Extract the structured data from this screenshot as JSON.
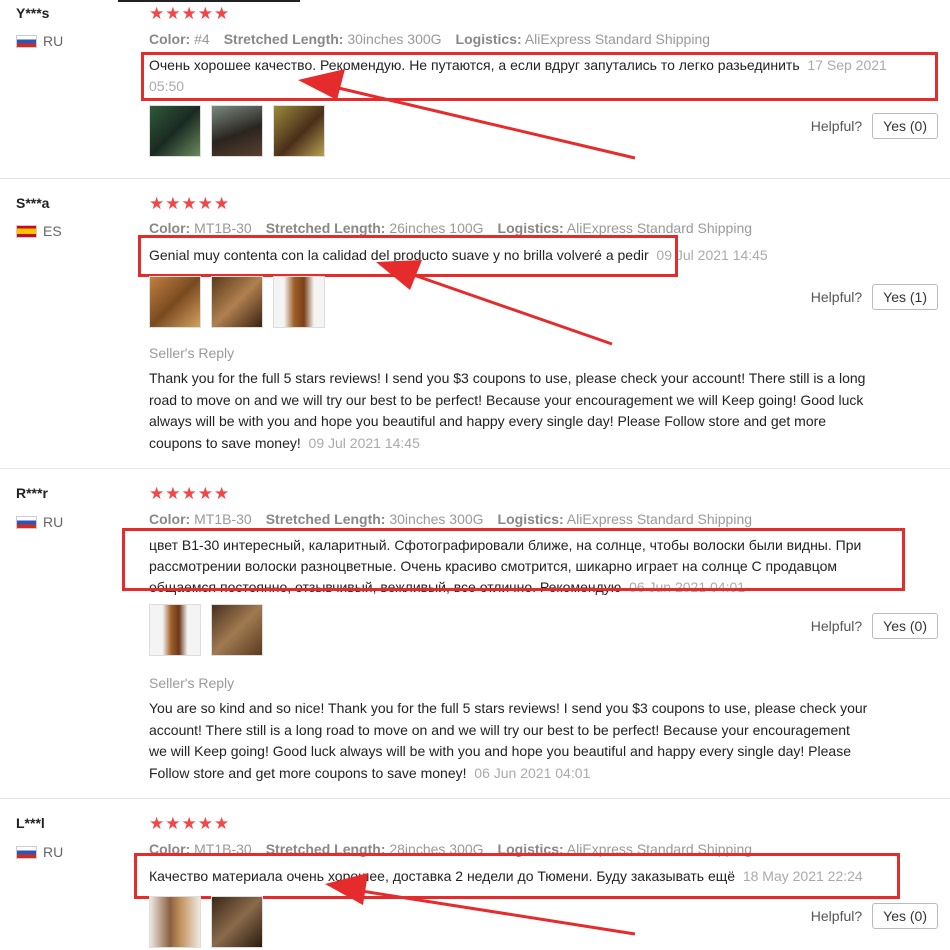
{
  "reviews": [
    {
      "user": "Y***s",
      "country": "RU",
      "flag": "ru",
      "stars": "★★★★★",
      "color_label": "Color:",
      "color": "#4",
      "length_label": "Stretched Length:",
      "length": "30inches 300G",
      "logistics_label": "Logistics:",
      "logistics": "AliExpress Standard Shipping",
      "text": "Очень хорошее качество. Рекомендую. Не путаются, а если вдруг запутались то легко разьединить",
      "date": "17 Sep 2021 05:50",
      "helpful_label": "Helpful?",
      "yes_label": "Yes (0)",
      "thumbs": [
        "person-dark-hair",
        "person-curly-hair",
        "long-curly-hair"
      ]
    },
    {
      "user": "S***a",
      "country": "ES",
      "flag": "es",
      "stars": "★★★★★",
      "color_label": "Color:",
      "color": "MT1B-30",
      "length_label": "Stretched Length:",
      "length": "26inches 100G",
      "logistics_label": "Logistics:",
      "logistics": "AliExpress Standard Shipping",
      "text": "Genial muy contenta con la calidad del producto suave y no brilla volveré a pedir",
      "date": "09 Jul 2021 14:45",
      "helpful_label": "Helpful?",
      "yes_label": "Yes (1)",
      "thumbs": [
        "blonde-braid",
        "curly-pack",
        "brown-curls"
      ],
      "reply_title": "Seller's Reply",
      "reply_text": "Thank you for the full 5 stars reviews! I send you $3 coupons to use, please check your account! There still is a long road to move on and we will try our best to be perfect! Because your encouragement we will Keep going! Good luck always will be with you and hope you beautiful and happy every single day! Please Follow store and get more coupons to save money!",
      "reply_date": "09 Jul 2021 14:45"
    },
    {
      "user": "R***r",
      "country": "RU",
      "flag": "ru",
      "stars": "★★★★★",
      "color_label": "Color:",
      "color": "MT1B-30",
      "length_label": "Stretched Length:",
      "length": "30inches 300G",
      "logistics_label": "Logistics:",
      "logistics": "AliExpress Standard Shipping",
      "text": "цвет В1-30 интересный, каларитный. Сфотографировали ближе, на солнце, чтобы волоски были видны. При рассмотрении волоски разноцветные. Очень красиво смотрится, шикарно играет на солнце С продавцом общаемся постоянно, отзывчивый, вежливый, все отлично. Рекомендую",
      "date": "06 Jun 2021 04:01",
      "helpful_label": "Helpful?",
      "yes_label": "Yes (0)",
      "thumbs": [
        "braid-strand",
        "curly-closeup"
      ],
      "reply_title": "Seller's Reply",
      "reply_text": "You are so kind and so nice! Thank you for the full 5 stars reviews! I send you $3 coupons to use, please check your account! There still is a long road to move on and we will try our best to be perfect! Because your encouragement we will Keep going! Good luck always will be with you and hope you beautiful and happy every single day! Please Follow store and get more coupons to save money!",
      "reply_date": "06 Jun 2021 04:01"
    },
    {
      "user": "L***l",
      "country": "RU",
      "flag": "ru",
      "stars": "★★★★★",
      "color_label": "Color:",
      "color": "MT1B-30",
      "length_label": "Stretched Length:",
      "length": "28inches 300G",
      "logistics_label": "Logistics:",
      "logistics": "AliExpress Standard Shipping",
      "text": "Качество материала очень хорошее, доставка 2 недели до Тюмени. Буду заказывать ещё",
      "date": "18 May 2021 22:24",
      "helpful_label": "Helpful?",
      "yes_label": "Yes (0)",
      "thumbs": [
        "woman-long-hair",
        "braids-closeup"
      ]
    }
  ],
  "colors": {
    "star": "#f04848",
    "highlight": "#e52b2b",
    "muted": "#999999"
  }
}
